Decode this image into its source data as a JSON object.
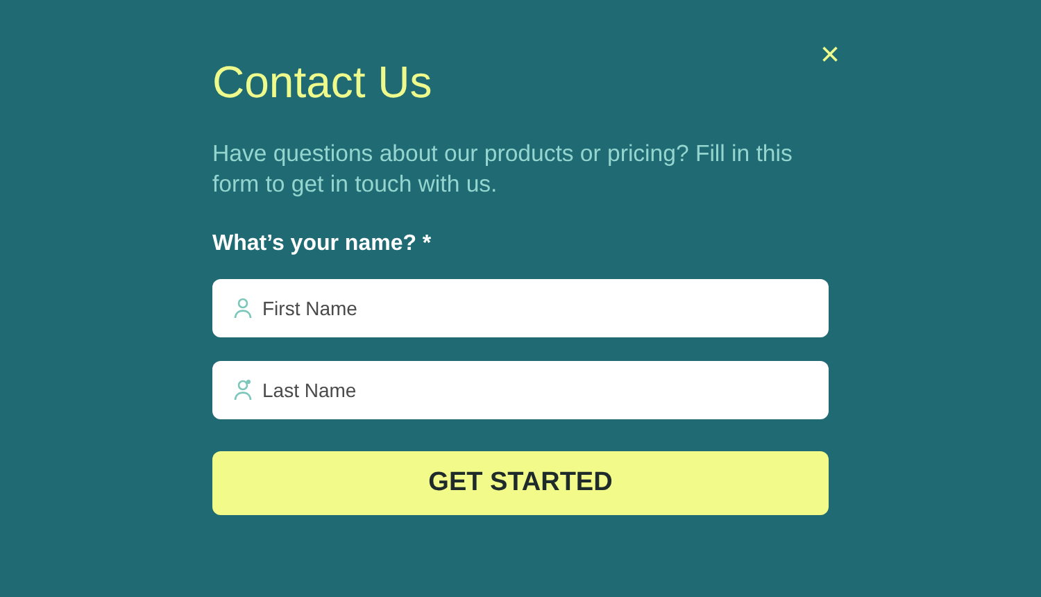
{
  "close": "×",
  "title": "Contact Us",
  "description": "Have questions about our products or pricing? Fill in this form to get in touch with us.",
  "label": "What’s your name? *",
  "fields": [
    {
      "placeholder": "First Name"
    },
    {
      "placeholder": "Last Name"
    }
  ],
  "button": "GET STARTED"
}
